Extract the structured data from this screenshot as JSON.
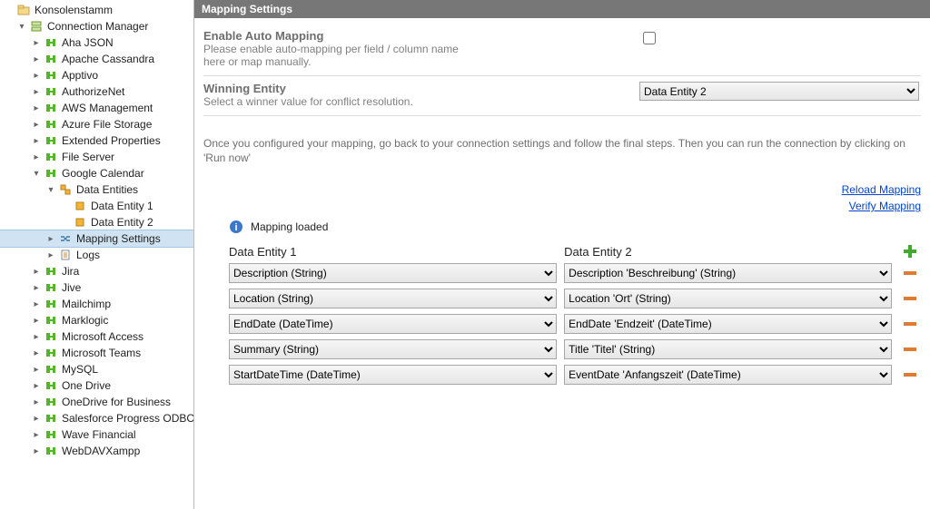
{
  "tree": {
    "root": "Konsolenstamm",
    "connection_manager": "Connection Manager",
    "connectors": [
      "Aha JSON",
      "Apache Cassandra",
      "Apptivo",
      "AuthorizeNet",
      "AWS Management",
      "Azure File Storage",
      "Extended Properties",
      "File Server"
    ],
    "google_calendar": "Google Calendar",
    "data_entities_label": "Data Entities",
    "data_entity_1": "Data Entity 1",
    "data_entity_2": "Data Entity 2",
    "mapping_settings": "Mapping Settings",
    "logs": "Logs",
    "connectors_after": [
      "Jira",
      "Jive",
      "Mailchimp",
      "Marklogic",
      "Microsoft Access",
      "Microsoft Teams",
      "MySQL",
      "One Drive",
      "OneDrive for Business",
      "Salesforce Progress ODBC",
      "Wave Financial",
      "WebDAVXampp"
    ]
  },
  "header": {
    "title": "Mapping Settings"
  },
  "enable_auto": {
    "title": "Enable Auto Mapping",
    "desc1": "Please enable auto-mapping per field / column name",
    "desc2": "here or map manually."
  },
  "winning_entity": {
    "title": "Winning Entity",
    "desc": "Select a winner value for conflict resolution.",
    "value": "Data Entity 2"
  },
  "instructions": "Once you configured your mapping, go back to your connection settings and follow the final steps. Then you can run the connection by clicking on 'Run now'",
  "links": {
    "reload": "Reload Mapping",
    "verify": "Verify Mapping"
  },
  "status": "Mapping loaded",
  "mapping": {
    "col_a_head": "Data Entity 1",
    "col_b_head": "Data Entity 2",
    "rows": [
      {
        "a": "Description (String)",
        "b": "Description 'Beschreibung' (String)"
      },
      {
        "a": "Location (String)",
        "b": "Location 'Ort' (String)"
      },
      {
        "a": "EndDate (DateTime)",
        "b": "EndDate 'Endzeit' (DateTime)"
      },
      {
        "a": "Summary (String)",
        "b": "Title 'Titel' (String)"
      },
      {
        "a": "StartDateTime (DateTime)",
        "b": "EventDate 'Anfangszeit' (DateTime)"
      }
    ]
  }
}
